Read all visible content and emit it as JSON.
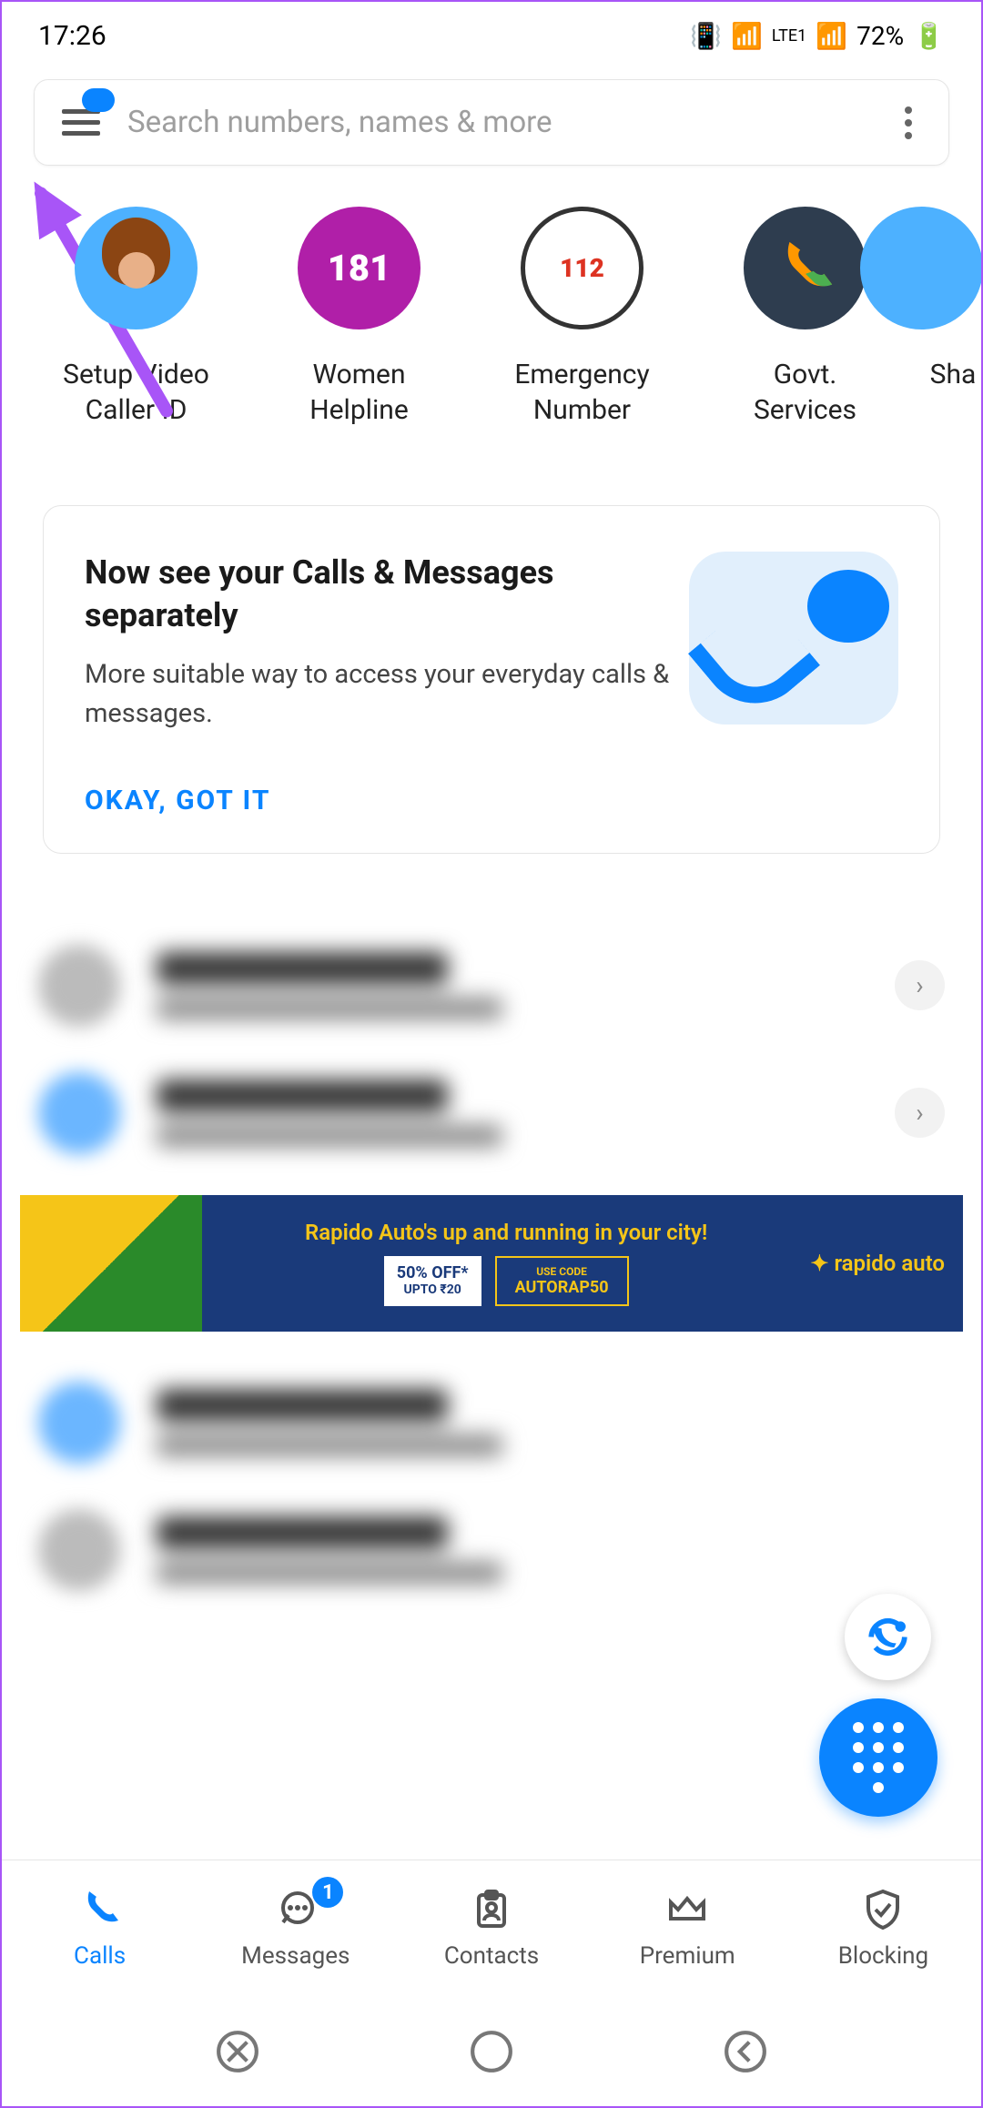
{
  "status": {
    "time": "17:26",
    "battery": "72%",
    "network": "LTE1"
  },
  "search": {
    "placeholder": "Search numbers, names & more"
  },
  "shortcuts": [
    {
      "label": "Setup Video\nCaller ID"
    },
    {
      "label": "Women\nHelpline",
      "tag": "181"
    },
    {
      "label": "Emergency\nNumber",
      "tag": "112"
    },
    {
      "label": "Govt.\nServices"
    },
    {
      "label": "Sha"
    }
  ],
  "info_card": {
    "title": "Now see your Calls & Messages separately",
    "desc": "More suitable way to access your everyday calls & messages.",
    "action": "OKAY, GOT IT"
  },
  "ad": {
    "title": "Rapido Auto's up and running in your city!",
    "offer1_line1": "50% OFF*",
    "offer1_line2": "UPTO ₹20",
    "offer2_line1": "USE CODE",
    "offer2_line2": "AUTORAP50",
    "brand": "rapido auto"
  },
  "nav": {
    "calls": "Calls",
    "messages": "Messages",
    "messages_badge": "1",
    "contacts": "Contacts",
    "premium": "Premium",
    "blocking": "Blocking"
  }
}
